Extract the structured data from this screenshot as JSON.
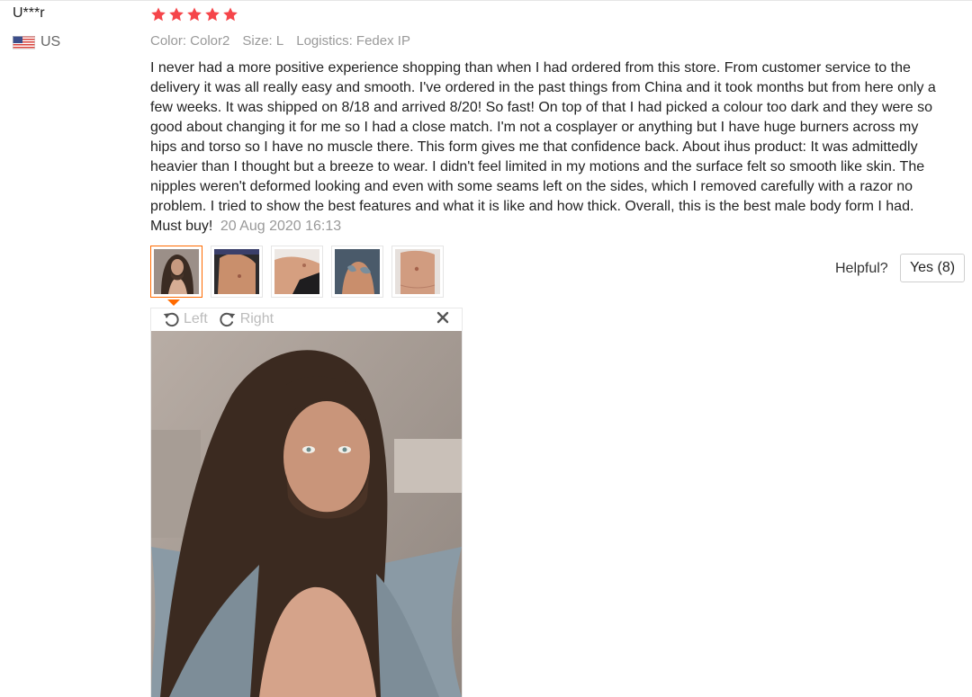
{
  "review": {
    "user_name": "U***r",
    "country": "US",
    "rating": 5,
    "color": "Color: Color2",
    "size": "Size: L",
    "logistics": "Logistics: Fedex IP",
    "text": "I never had a more positive experience shopping than when I had ordered from this store. From customer service to the delivery it was all really easy and smooth. I've ordered in the past things from China and it took months but from here only a few weeks. It was shipped on 8/18 and arrived 8/20! So fast! On top of that I had picked a colour too dark and they were so good about changing it for me so I had a close match. I'm not a cosplayer or anything but I have huge burners across my hips and torso so I have no muscle there. This form gives me that confidence back. About ihus product: It was admittedly heavier than I thought but a breeze to wear. I didn't feel limited in my motions and the surface felt so smooth like skin. The nipples weren't deformed looking and even with some seams left on the sides, which I removed carefully with a razor no problem. I tried to show the best features and what it is like and how thick. Overall, this is the best male body form I had. Must buy!",
    "date": "20 Aug 2020 16:13"
  },
  "helpful": {
    "label": "Helpful?",
    "yes_label": "Yes (8)"
  },
  "viewer": {
    "left_label": "Left",
    "right_label": "Right"
  },
  "icons": {
    "star": "star-icon",
    "flag": "us-flag-icon",
    "rotate_left": "rotate-left-icon",
    "rotate_right": "rotate-right-icon",
    "close": "close-icon"
  },
  "colors": {
    "star": "#f5454a",
    "accent": "#ff6a00",
    "muted": "#999999"
  }
}
